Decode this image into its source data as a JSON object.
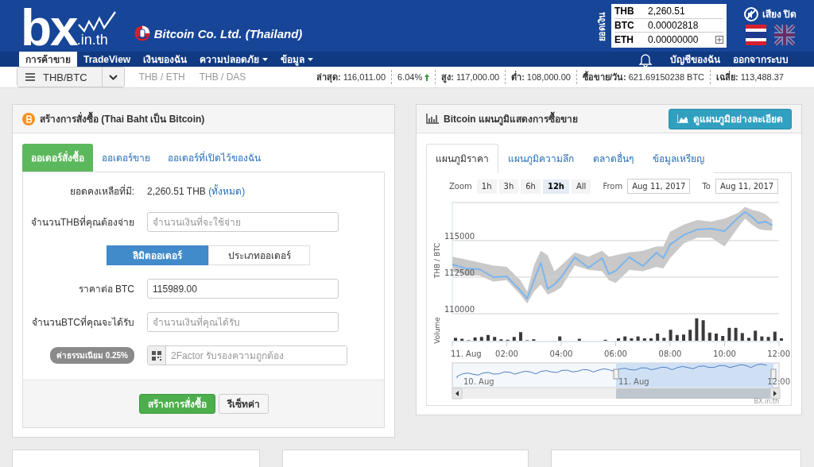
{
  "header": {
    "logo": {
      "main": "bx",
      "sub": ".in.th"
    },
    "company": "Bitcoin Co. Ltd. (Thailand)",
    "balance_label": "ยอดเงิน",
    "balances": [
      {
        "currency": "THB",
        "amount": "2,260.51"
      },
      {
        "currency": "BTC",
        "amount": "0.00002818"
      },
      {
        "currency": "ETH",
        "amount": "0.00000000"
      }
    ],
    "sound": "เสียง ปิด",
    "languages": [
      {
        "kind": "thai",
        "selected": true
      },
      {
        "kind": "uk",
        "selected": false
      }
    ]
  },
  "nav": {
    "items": [
      {
        "label": "การค้าขาย",
        "selected": true,
        "dropdown": false
      },
      {
        "label": "TradeView",
        "selected": false,
        "dropdown": false
      },
      {
        "label": "เงินของฉัน",
        "selected": false,
        "dropdown": false
      },
      {
        "label": "ความปลอดภัย",
        "selected": false,
        "dropdown": true
      },
      {
        "label": "ข้อมูล",
        "selected": false,
        "dropdown": true
      }
    ],
    "right": [
      "บัญชีของฉัน",
      "ออกจากระบบ"
    ]
  },
  "ticker": {
    "pair": "THB/BTC",
    "other_pairs": [
      "THB / ETH",
      "THB / DAS"
    ],
    "stats": [
      {
        "kind": "labeled",
        "label": "ล่าสุด:",
        "value": "116,011.00"
      },
      {
        "kind": "change",
        "value": "6.04%"
      },
      {
        "kind": "labeled",
        "label": "สูง:",
        "value": "117,000.00"
      },
      {
        "kind": "labeled",
        "label": "ต่ำ:",
        "value": "108,000.00"
      },
      {
        "kind": "labeled",
        "label": "ซื้อขาย/วัน:",
        "value": "621.69150238 BTC"
      },
      {
        "kind": "labeled",
        "label": "เฉลี่ย:",
        "value": "113,488.37"
      }
    ]
  },
  "order_panel": {
    "title": "สร้างการสั่งซื้อ (Thai Baht เป็น Bitcoin)",
    "tabs": [
      {
        "label": "ออเดอร์สั่งซื้อ",
        "selected": true
      },
      {
        "label": "ออเดอร์ขาย",
        "selected": false
      },
      {
        "label": "ออเดอร์ที่เปิดไว้ของฉัน",
        "selected": false
      }
    ],
    "balance": {
      "label": "ยอดคงเหลือที่มี:",
      "value": "2,260.51 THB",
      "link": "(ทั้งหมด)"
    },
    "amount_field": {
      "label": "จำนวนTHBที่คุณต้องจ่าย",
      "placeholder": "จำนวนเงินที่จะใช้จ่าย"
    },
    "order_types": [
      {
        "label": "ลิมิตออเดอร์",
        "selected": true
      },
      {
        "label": "ประเภทออเดอร์",
        "selected": false
      }
    ],
    "price_field": {
      "label": "ราคาต่อ BTC",
      "value": "115989.00"
    },
    "receive_field": {
      "label": "จำนวนBTCที่คุณจะได้รับ",
      "placeholder": "จำนวนเงินที่คุณได้รับ"
    },
    "fee": "ค่าธรรมเนียม 0.25%",
    "twofactor": {
      "placeholder": "2Factor รับรองความถูกต้อง"
    },
    "buttons": [
      {
        "label": "สร้างการสั่งซื้อ",
        "kind": "primary"
      },
      {
        "label": "รีเซ็ทค่า",
        "kind": "default"
      }
    ]
  },
  "chart_panel": {
    "title": "Bitcoin แผนภูมิแสดงการซื้อขาย",
    "detail_button": "ดูแผนภูมิอย่างละเอียด",
    "tabs": [
      {
        "label": "แผนภูมิราคา",
        "selected": true
      },
      {
        "label": "แผนภูมิความลึก",
        "selected": false
      },
      {
        "label": "ตลาดอื่นๆ",
        "selected": false
      },
      {
        "label": "ข้อมูลเหรียญ",
        "selected": false
      }
    ],
    "zoom_label": "Zoom",
    "zoom_options": [
      {
        "label": "1h",
        "selected": false
      },
      {
        "label": "3h",
        "selected": false
      },
      {
        "label": "6h",
        "selected": false
      },
      {
        "label": "12h",
        "selected": true
      },
      {
        "label": "All",
        "selected": false
      }
    ],
    "from_label": "From",
    "from": "Aug 11, 2017",
    "to_label": "To",
    "to": "Aug 11, 2017",
    "chart_data": {
      "type": "line",
      "ylabel": "THB / BTC",
      "x": [
        0,
        0.5,
        1,
        1.5,
        2,
        2.5,
        2.75,
        3,
        3.25,
        3.5,
        3.75,
        4,
        4.5,
        5,
        5.5,
        5.75,
        6,
        6.5,
        7,
        7.5,
        7.75,
        8,
        8.5,
        9,
        9.5,
        10,
        10.5,
        10.75,
        11,
        11.25,
        11.5,
        11.75
      ],
      "series": [
        {
          "color": "#7cb5ec",
          "values": [
            113370,
            113100,
            113040,
            112500,
            112550,
            111580,
            111030,
            112280,
            113480,
            111690,
            112000,
            112500,
            113860,
            113150,
            113800,
            112720,
            112930,
            113860,
            113260,
            114180,
            113800,
            114730,
            115380,
            115760,
            115810,
            115650,
            116570,
            116950,
            116630,
            116190,
            116300,
            116030
          ]
        }
      ],
      "xlim": [
        0,
        12
      ],
      "ylim": [
        110000,
        117600
      ],
      "xticks": [
        {
          "value": 0,
          "label": "11. Aug"
        },
        {
          "value": 2,
          "label": "02:00"
        },
        {
          "value": 4,
          "label": "04:00"
        },
        {
          "value": 6,
          "label": "06:00"
        },
        {
          "value": 8,
          "label": "08:00"
        },
        {
          "value": 10,
          "label": "10:00"
        },
        {
          "value": 12,
          "label": "12:00"
        }
      ],
      "yticks": [
        110000,
        112500,
        115000
      ]
    },
    "volume_label": "Volume",
    "navigator_labels": [
      "10. Aug",
      "11. Aug",
      "12:00"
    ],
    "credit": "BX.in.th"
  }
}
